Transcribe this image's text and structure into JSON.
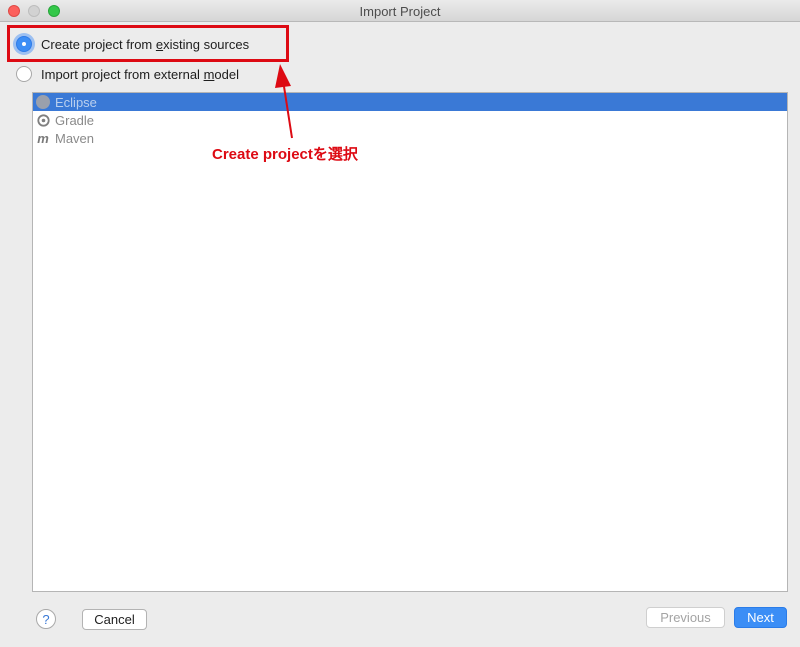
{
  "window": {
    "title": "Import Project"
  },
  "options": {
    "create": {
      "before": "Create project from ",
      "mnemonic": "e",
      "after": "xisting sources"
    },
    "import": {
      "before": "Import project from external ",
      "mnemonic": "m",
      "after": "odel"
    }
  },
  "models": [
    {
      "label": "Eclipse",
      "icon": "eclipse-icon",
      "selected": true
    },
    {
      "label": "Gradle",
      "icon": "gradle-icon",
      "selected": false
    },
    {
      "label": "Maven",
      "icon": "maven-icon",
      "selected": false
    }
  ],
  "annotation": {
    "label": "Create projectを選択",
    "color": "#dd0a13"
  },
  "footer": {
    "help": "?",
    "cancel": "Cancel",
    "previous": "Previous",
    "next": "Next"
  },
  "colors": {
    "accent": "#3b8ef6",
    "selection": "#3a79d6"
  }
}
